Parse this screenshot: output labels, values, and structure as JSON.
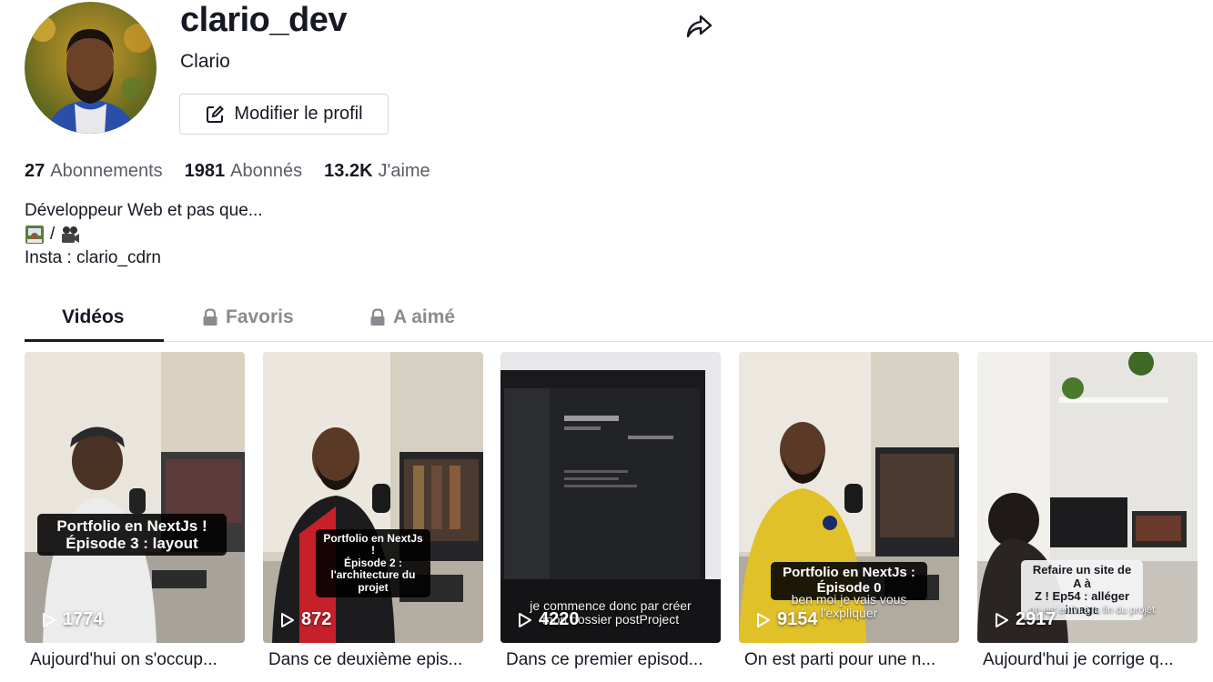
{
  "profile": {
    "username": "clario_dev",
    "nickname": "Clario",
    "edit_label": "Modifier le profil"
  },
  "stats": [
    {
      "value": "27",
      "label": "Abonnements"
    },
    {
      "value": "1981",
      "label": "Abonnés"
    },
    {
      "value": "13.2K",
      "label": "J'aime"
    }
  ],
  "bio": {
    "line1": "Développeur Web et pas que...",
    "line2_sep": "/",
    "line3": "Insta : clario_cdrn"
  },
  "tabs": [
    {
      "label": "Vidéos",
      "locked": false
    },
    {
      "label": "Favoris",
      "locked": true
    },
    {
      "label": "A aimé",
      "locked": true
    }
  ],
  "videos": [
    {
      "views": "1774",
      "caption": "Portfolio en NextJs !\nÉpisode 3 : layout",
      "subtitle": "",
      "description": "Aujourd'hui on s'occup..."
    },
    {
      "views": "872",
      "caption": "Portfolio en NextJs !\nÉpisode 2 :\nl'architecture du\nprojet",
      "subtitle": "",
      "description": "Dans ce deuxième epis..."
    },
    {
      "views": "4220",
      "caption": "",
      "subtitle": "je commence donc par créer\nmon dossier postProject",
      "description": "Dans ce premier episod..."
    },
    {
      "views": "9154",
      "caption": "Portfolio en NextJs :\nÉpisode 0",
      "subtitle": "ben moi je vais vous\nl'expliquer",
      "description": "On est parti pour une n..."
    },
    {
      "views": "2917",
      "caption": "Refaire un site de A à\nZ ! Ep54 : alléger\nimage",
      "subtitle": "on est enfin à la fin du projet",
      "description": "Aujourd'hui je corrige q..."
    }
  ],
  "colors": {
    "text": "#161823",
    "muted": "#8a8b91",
    "border": "#e3e3e4"
  }
}
